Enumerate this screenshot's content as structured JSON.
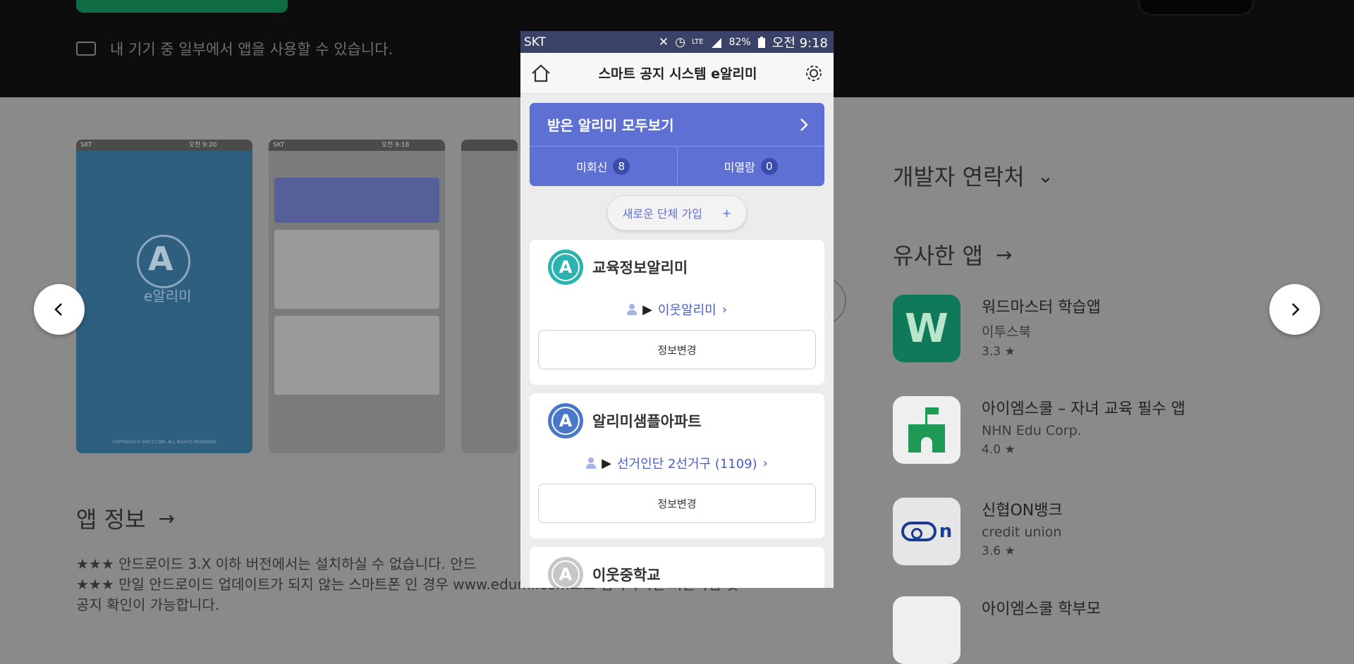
{
  "store": {
    "device_notice": "내 기기 중 일부에서 앱을 사용할 수 있습니다.",
    "developer_contact": "개발자 연락처",
    "similar_apps": "유사한 앱",
    "app_info": "앱 정보",
    "description_lines": [
      "★★★ 안드로이드 3.X 이하 버전에서는 설치하실 수 없습니다. 안드",
      "★★★ 만일 안드로이드 업데이트가 되지 않는 스마트폰 인 경우 www.edumi.com으로 접속하시면 회원가입 및",
      "공지 확인이 가능합니다."
    ],
    "similar": [
      {
        "name": "워드마스터 학습앱",
        "developer": "이투스북",
        "rating": "3.3 ★",
        "icon": "wordmaster-icon",
        "color": "#0f7a5a"
      },
      {
        "name": "아이엠스쿨 – 자녀 교육 필수 앱",
        "developer": "NHN Edu Corp.",
        "rating": "4.0 ★",
        "icon": "iamschool-icon",
        "color": "#1e9a55"
      },
      {
        "name": "신협ON뱅크",
        "developer": "credit union",
        "rating": "3.6 ★",
        "icon": "shinhyup-icon",
        "color": "#1a3c8f"
      },
      {
        "name": "아이엠스쿨 학부모",
        "developer": "",
        "rating": "",
        "icon": "iamschool-parent-icon",
        "color": "#1e9a55"
      }
    ],
    "thumb_text": {
      "time": "오전 9:20",
      "brand": "e알리미",
      "footer": "COPYRIGHT© EMCT.COM. ALL RIGHTS RESERVED",
      "time2": "오전 9:18"
    }
  },
  "phone": {
    "status": {
      "carrier": "SKT",
      "battery": "82%",
      "time": "오전 9:18",
      "network": "LTE"
    },
    "appbar": {
      "title": "스마트 공지 시스템 e알리미"
    },
    "banner": {
      "title": "받은 알리미 모두보기",
      "unreceived_label": "미회신",
      "unreceived_count": "8",
      "unread_label": "미열람",
      "unread_count": "0"
    },
    "join": {
      "label": "새로운 단체 가입",
      "plus": "+"
    },
    "cards": [
      {
        "name": "교육정보알리미",
        "link": "이웃알리미",
        "button": "정보변경",
        "logo_color": "#2ab3b0"
      },
      {
        "name": "알리미샘플아파트",
        "link": "선거인단 2선거구 (1109)",
        "button": "정보변경",
        "logo_color": "#4a78c8"
      },
      {
        "name": "이웃중학교",
        "logo_color": "#c7c7c7"
      }
    ]
  },
  "colors": {
    "accent": "#5e70d3",
    "status_bar": "#3a4267",
    "overlay_bg": "#8a8a8a"
  }
}
